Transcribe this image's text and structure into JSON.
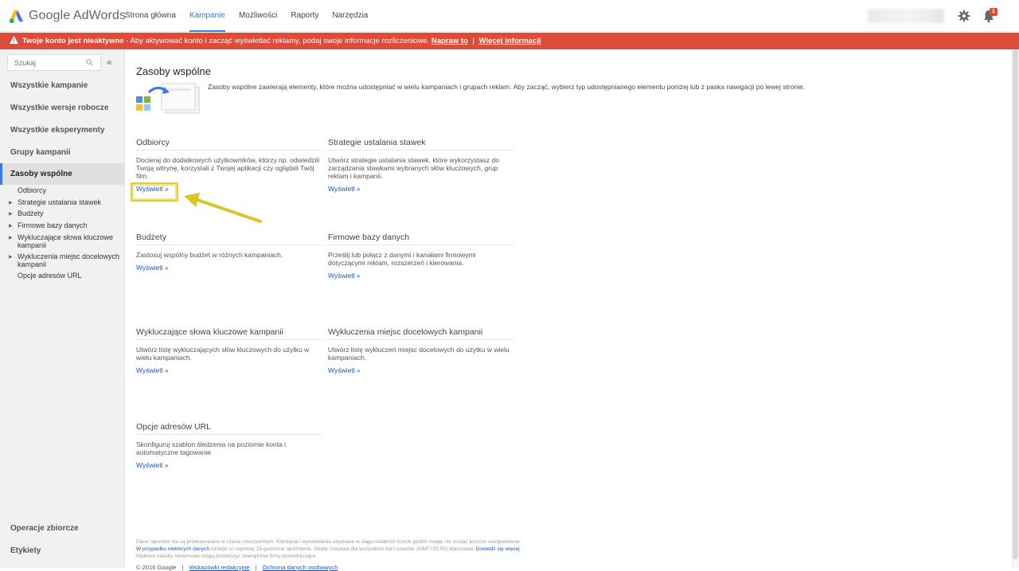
{
  "topbar": {
    "logo_text": "Google AdWords",
    "nav": [
      "Strona główna",
      "Kampanie",
      "Możliwości",
      "Raporty",
      "Narzędzia"
    ],
    "active_nav": "Kampanie",
    "notification_count": "1"
  },
  "alert": {
    "bold_text": "Twoje konto jest nieaktywne",
    "text": " - Aby aktywować konto i zacząć wyświetlać reklamy, podaj swoje informacje rozliczeniowe.",
    "fix_link": "Napraw to",
    "separator": "|",
    "more_link": "Więcej informacji"
  },
  "sidebar": {
    "search_placeholder": "Szukaj",
    "collapse": "«",
    "items": [
      "Wszystkie kampanie",
      "Wszystkie wersje robocze",
      "Wszystkie eksperymenty",
      "Grupy kampanii",
      "Zasoby wspólne"
    ],
    "active_item": "Zasoby wspólne",
    "subitems": [
      {
        "label": "Odbiorcy",
        "expandable": false
      },
      {
        "label": "Strategie ustalania stawek",
        "expandable": true
      },
      {
        "label": "Budżety",
        "expandable": true
      },
      {
        "label": "Firmowe bazy danych",
        "expandable": true
      },
      {
        "label": "Wykluczające słowa kluczowe kampanii",
        "expandable": true
      },
      {
        "label": "Wykluczenia miejsc docelowych kampanii",
        "expandable": true
      },
      {
        "label": "Opcje adresów URL",
        "expandable": false
      }
    ],
    "bottom_items": [
      "Operacje zbiorcze",
      "Etykiety"
    ]
  },
  "main": {
    "title": "Zasoby wspólne",
    "intro": "Zasoby wspólne zawierają elementy, które można udostępniać w wielu kampaniach i grupach reklam. Aby zacząć, wybierz typ udostępnianego elementu poniżej lub z paska nawigacji po lewej stronie.",
    "cards": [
      {
        "title": "Odbiorcy",
        "desc": "Docieraj do dodatkowych użytkowników, którzy np. odwiedzili Twoją witrynę, korzystali z Twojej aplikacji czy oglądali Twój film.",
        "link": "Wyświetl »"
      },
      {
        "title": "Strategie ustalania stawek",
        "desc": "Utwórz strategie ustalania stawek, które wykorzystasz do zarządzania stawkami wybranych słów kluczowych, grup reklam i kampanii.",
        "link": "Wyświetl »"
      },
      {
        "title": "Budżety",
        "desc": "Zastosuj wspólny budżet w różnych kampaniach.",
        "link": "Wyświetl »"
      },
      {
        "title": "Firmowe bazy danych",
        "desc": "Prześlij lub połącz z danymi i kanałami firmowymi dotyczącymi reklam, rozszerzeń i kierowania.",
        "link": "Wyświetl »"
      },
      {
        "title": "Wykluczające słowa kluczowe kampanii",
        "desc": "Utwórz listę wykluczających słów kluczowych do użytku w wielu kampaniach.",
        "link": "Wyświetl »"
      },
      {
        "title": "Wykluczenia miejsc docelowych kampanii",
        "desc": "Utwórz listę wykluczeń miejsc docelowych do użytku w wielu kampaniach.",
        "link": "Wyświetl »"
      },
      {
        "title": "Opcje adresów URL",
        "desc": "Skonfiguruj szablon śledzenia na poziomie konta i automatyczne tagowanie",
        "link": "Wyświetl »"
      }
    ]
  },
  "footer": {
    "line1": "Dane raportów nie są przekazywane w czasie rzeczywistym. Kliknięcia i wyświetlenia uzyskane w ciągu ostatnich trzech godzin mogły nie zostać jeszcze uwzględnione.",
    "line2_link": "W przypadku niektórych danych",
    "line2": " istnieje co najmniej 15-godzinne opóźnienie. Strefa czasowa dla wszystkich dat i czasów: (GMT+02:00) Warszawa.",
    "learn_more": "Dowiedz się więcej",
    "line3": "Niektóre zasoby reklamowe mogą dostarczyć zewnętrzne firmy pośredniczące.",
    "copyright": "© 2016 Google",
    "sep": "|",
    "link1": "Wskazówki redakcyjne",
    "link2": "Ochrona danych osobowych"
  },
  "colors": {
    "accent": "#3b78e7",
    "alert_bg": "#dd4b39",
    "highlight": "#e1cd3a"
  }
}
